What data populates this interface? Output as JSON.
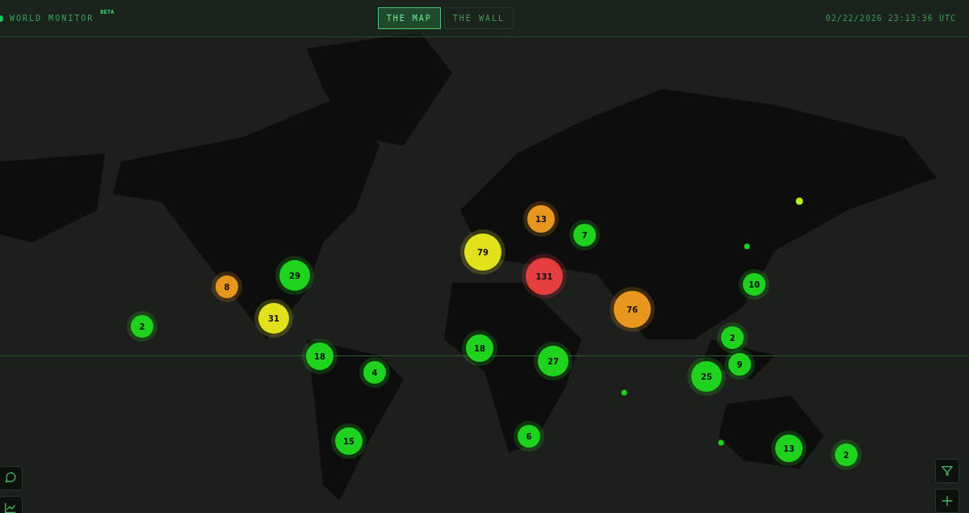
{
  "header": {
    "title": "WORLD MONITOR",
    "badge": "BETA",
    "tabs": [
      {
        "label": "THE MAP",
        "selected": true
      },
      {
        "label": "THE WALL",
        "selected": false
      }
    ],
    "clock": "02/22/2026 23:13:36 UTC"
  },
  "map": {
    "markers": [
      {
        "kind": "cluster",
        "count": "13",
        "color": "#e8961e"
      },
      {
        "kind": "cluster",
        "count": "7",
        "color": "#1ed21e"
      },
      {
        "kind": "cluster",
        "count": "79",
        "color": "#e2e21c"
      },
      {
        "kind": "cluster",
        "count": "131",
        "color": "#e53e3e"
      },
      {
        "kind": "cluster",
        "count": "29",
        "color": "#1ed21e"
      },
      {
        "kind": "cluster",
        "count": "8",
        "color": "#e8961e"
      },
      {
        "kind": "cluster",
        "count": "31",
        "color": "#e2e21c"
      },
      {
        "kind": "cluster",
        "count": "2",
        "color": "#1ed21e"
      },
      {
        "kind": "cluster",
        "count": "10",
        "color": "#1ed21e"
      },
      {
        "kind": "cluster",
        "count": "76",
        "color": "#e8961e"
      },
      {
        "kind": "cluster",
        "count": "2",
        "color": "#1ed21e"
      },
      {
        "kind": "cluster",
        "count": "18",
        "color": "#1ed21e"
      },
      {
        "kind": "cluster",
        "count": "4",
        "color": "#1ed21e"
      },
      {
        "kind": "cluster",
        "count": "18",
        "color": "#1ed21e"
      },
      {
        "kind": "cluster",
        "count": "27",
        "color": "#1ed21e"
      },
      {
        "kind": "cluster",
        "count": "9",
        "color": "#1ed21e"
      },
      {
        "kind": "cluster",
        "count": "25",
        "color": "#1ed21e"
      },
      {
        "kind": "cluster",
        "count": "15",
        "color": "#1ed21e"
      },
      {
        "kind": "cluster",
        "count": "6",
        "color": "#1ed21e"
      },
      {
        "kind": "cluster",
        "count": "13",
        "color": "#1ed21e"
      },
      {
        "kind": "cluster",
        "count": "2",
        "color": "#1ed21e"
      },
      {
        "kind": "dot",
        "color": "#b4ee22"
      },
      {
        "kind": "dot",
        "color": "#1ed21e"
      },
      {
        "kind": "dot",
        "color": "#1ed21e"
      },
      {
        "kind": "dot",
        "color": "#1ed21e"
      }
    ]
  },
  "left_controls": [
    {
      "kind": "chat"
    },
    {
      "kind": "chart"
    }
  ],
  "right_controls": [
    {
      "kind": "filter"
    },
    {
      "kind": "plus"
    }
  ]
}
